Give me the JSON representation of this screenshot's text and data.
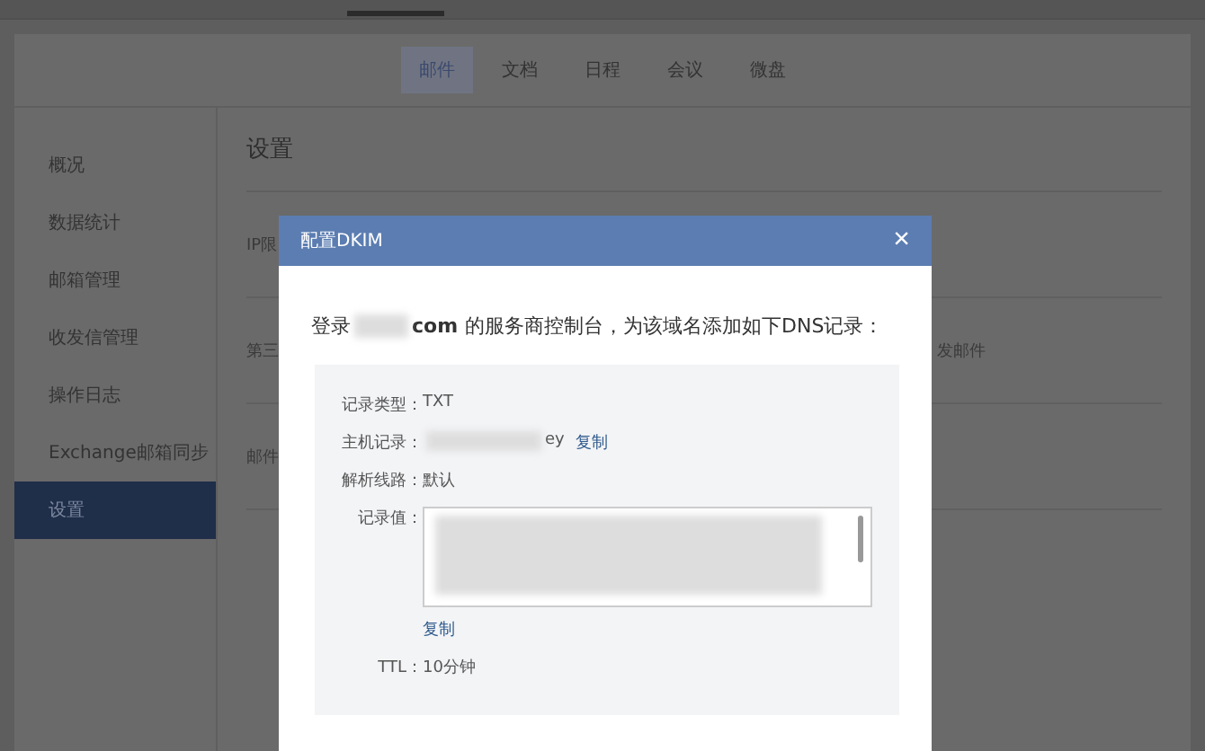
{
  "tabs": [
    {
      "label": "邮件",
      "selected": true
    },
    {
      "label": "文档",
      "selected": false
    },
    {
      "label": "日程",
      "selected": false
    },
    {
      "label": "会议",
      "selected": false
    },
    {
      "label": "微盘",
      "selected": false
    }
  ],
  "sidebar": {
    "items": [
      {
        "label": "概况",
        "selected": false
      },
      {
        "label": "数据统计",
        "selected": false
      },
      {
        "label": "邮箱管理",
        "selected": false
      },
      {
        "label": "收发信管理",
        "selected": false
      },
      {
        "label": "操作日志",
        "selected": false
      },
      {
        "label": "Exchange邮箱同步",
        "selected": false
      },
      {
        "label": "设置",
        "selected": true
      }
    ]
  },
  "main": {
    "title": "设置",
    "rows": [
      {
        "label": "IP限"
      },
      {
        "label": "第三",
        "note": "发邮件"
      },
      {
        "label": "邮件"
      }
    ]
  },
  "dialog": {
    "title": "配置DKIM",
    "close": "×",
    "intro": {
      "prefix": "登录",
      "domain": "com",
      "suffix": "的服务商控制台，为该域名添加如下DNS记录："
    },
    "records": [
      {
        "kind": "text",
        "label": "记录类型：",
        "value": "TXT"
      },
      {
        "kind": "copy",
        "label": "主机记录：",
        "value": "ey",
        "action": "复制"
      },
      {
        "kind": "text",
        "label": "解析线路：",
        "value": "默认"
      },
      {
        "kind": "textarea",
        "label": "记录值：",
        "action": "复制"
      },
      {
        "kind": "text",
        "label": "TTL：",
        "value": "10分钟"
      }
    ]
  }
}
